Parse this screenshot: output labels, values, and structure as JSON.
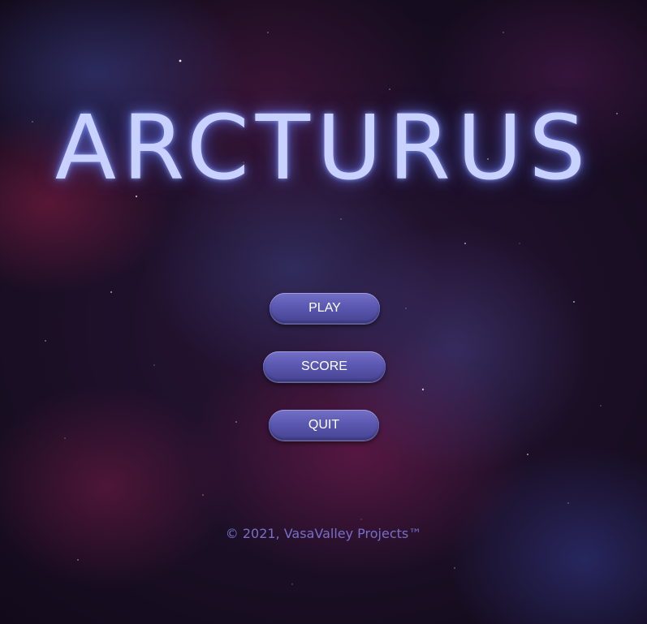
{
  "game": {
    "title": "ARCTURUS"
  },
  "menu": {
    "play_label": "PLAY",
    "score_label": "SCORE",
    "quit_label": "QUIT"
  },
  "footer": {
    "copyright": "© 2021, VasaValley Projects™"
  },
  "colors": {
    "title": "#c9d2ff",
    "button": "#5b58b2",
    "button_text": "#ffffff",
    "copyright": "#7470c8",
    "background": "#1b0f26"
  }
}
